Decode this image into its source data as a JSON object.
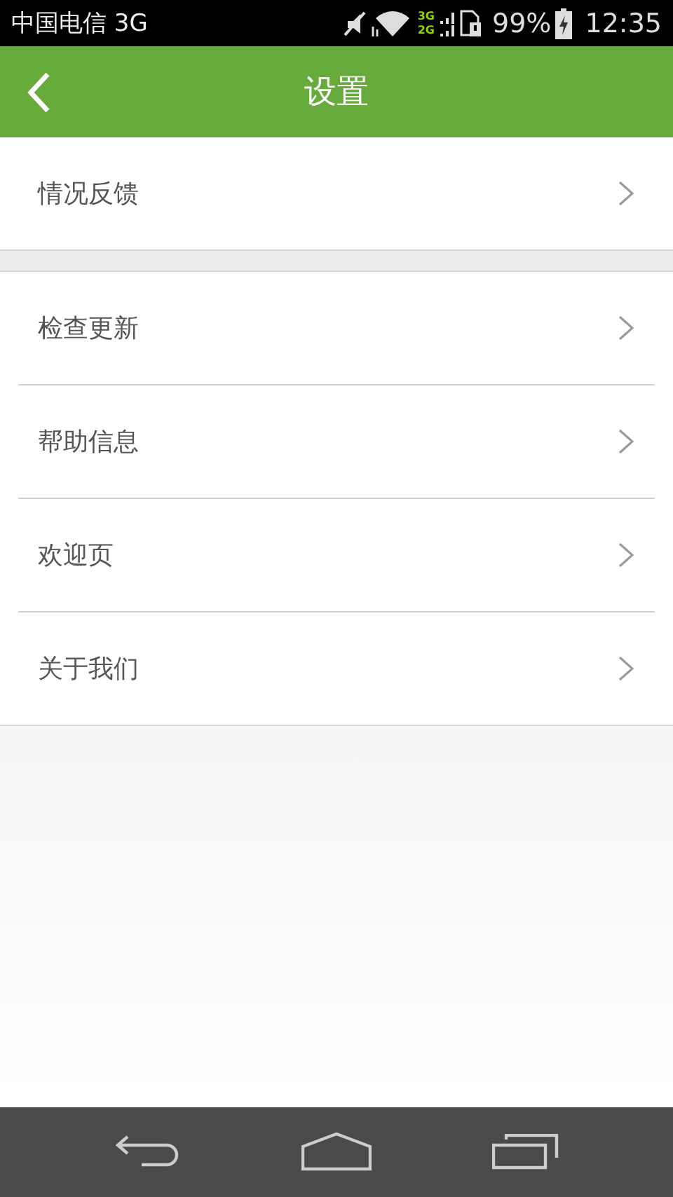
{
  "status_bar": {
    "carrier": "中国电信 3G",
    "network_labels": [
      "3G",
      "2G"
    ],
    "battery": "99%",
    "time": "12:35"
  },
  "header": {
    "title": "设置"
  },
  "sections": [
    {
      "items": [
        {
          "label": "情况反馈"
        }
      ]
    },
    {
      "items": [
        {
          "label": "检查更新"
        },
        {
          "label": "帮助信息"
        },
        {
          "label": "欢迎页"
        },
        {
          "label": "关于我们"
        }
      ]
    }
  ]
}
